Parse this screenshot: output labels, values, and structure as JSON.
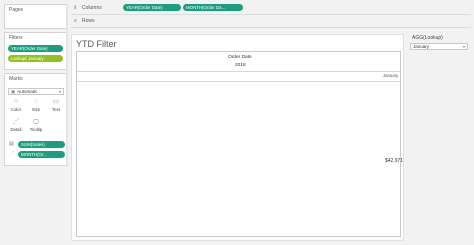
{
  "left": {
    "pages": {
      "title": "Pages"
    },
    "filters": {
      "title": "Filters",
      "pills": [
        {
          "label": "YEAR(Order Date)",
          "color": "#1a9e7f"
        },
        {
          "label": "Lookup( January",
          "color": "#95c11f"
        }
      ]
    },
    "marks": {
      "title": "Marks",
      "mark_type": "Automatic",
      "buttons": [
        {
          "label": "Color",
          "icon": "color-icon"
        },
        {
          "label": "Size",
          "icon": "size-icon"
        },
        {
          "label": "Text",
          "icon": "text-icon"
        },
        {
          "label": "Detail",
          "icon": "detail-icon"
        },
        {
          "label": "Tooltip",
          "icon": "tooltip-icon"
        }
      ],
      "fields": [
        {
          "label": "SUM(Sales)",
          "icon": "text-field-icon"
        },
        {
          "label": "MONTH(Or...",
          "icon": "detail-field-icon"
        }
      ]
    }
  },
  "shelves": {
    "columns": {
      "label": "Columns",
      "pills": [
        "YEAR(Order Date)",
        "MONTH(Order Da..."
      ]
    },
    "rows": {
      "label": "Rows"
    }
  },
  "sheet": {
    "title": "YTD Filter",
    "header_field": "Order Date",
    "year": "2018",
    "month": "January",
    "value": "$42,971"
  },
  "right": {
    "filter_card": {
      "title": "AGG(Lookup)",
      "selected": "January"
    }
  },
  "colors": {
    "pill_green": "#1a9e7f",
    "pill_lime": "#95c11f"
  }
}
